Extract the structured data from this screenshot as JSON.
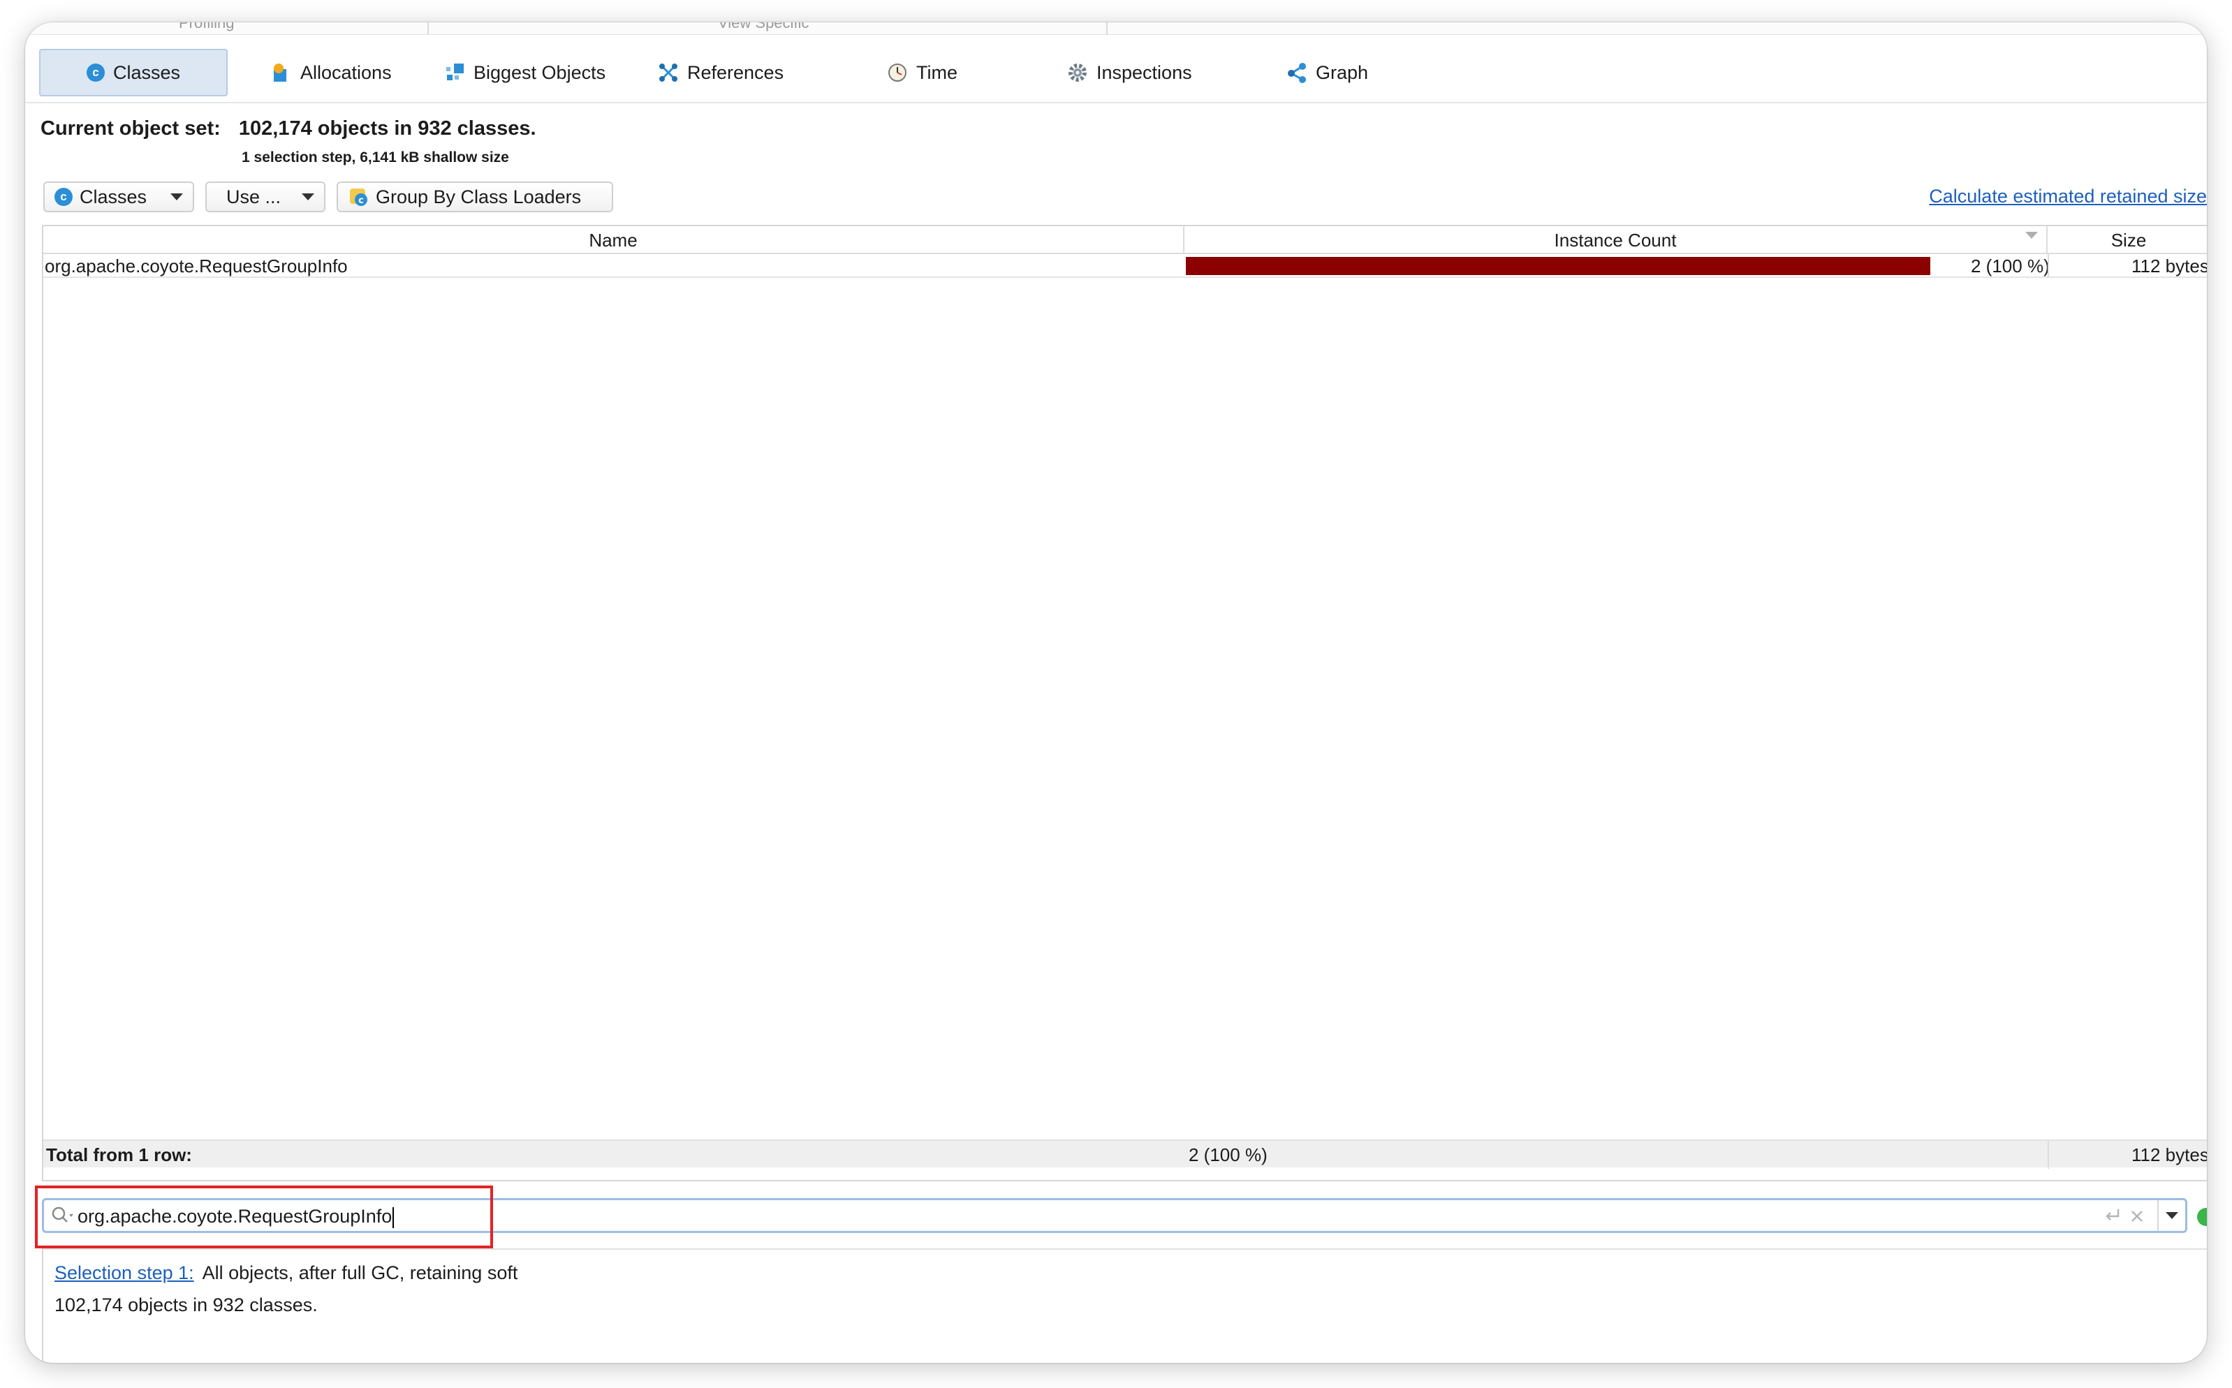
{
  "group_labels": {
    "profiling": "Profiling",
    "view_specific": "View Specific"
  },
  "tabs": [
    {
      "label": "Classes",
      "icon": "class-icon",
      "active": true
    },
    {
      "label": "Allocations",
      "icon": "allocations-icon"
    },
    {
      "label": "Biggest Objects",
      "icon": "biggest-objects-icon"
    },
    {
      "label": "References",
      "icon": "references-icon"
    },
    {
      "label": "Time",
      "icon": "clock-icon"
    },
    {
      "label": "Inspections",
      "icon": "gear-icon"
    },
    {
      "label": "Graph",
      "icon": "graph-icon"
    }
  ],
  "object_set": {
    "label": "Current object set:",
    "summary": "102,174 objects in 932 classes.",
    "detail": "1 selection step, 6,141 kB shallow size"
  },
  "toolbar": {
    "view_select": "Classes",
    "use_button": "Use ...",
    "group_button": "Group By Class Loaders",
    "retained_link": "Calculate estimated retained size"
  },
  "table": {
    "columns": [
      "Name",
      "Instance Count",
      "Size"
    ],
    "rows": [
      {
        "name": "org.apache.coyote.RequestGroupInfo",
        "count": "2 (100 %)",
        "count_fraction": 1.0,
        "size": "112 bytes"
      }
    ],
    "total": {
      "label": "Total from 1 row:",
      "count": "2 (100 %)",
      "size": "112 bytes"
    }
  },
  "search": {
    "value": "org.apache.coyote.RequestGroupInfo"
  },
  "selection": {
    "step_link": "Selection step 1:",
    "step_desc": "All objects, after full GC, retaining soft",
    "summary": "102,174 objects in 932 classes."
  },
  "colors": {
    "bar": "#8b0000",
    "link": "#1d5fbd",
    "highlight": "#e32323",
    "active_tab": "#dce7f3"
  }
}
